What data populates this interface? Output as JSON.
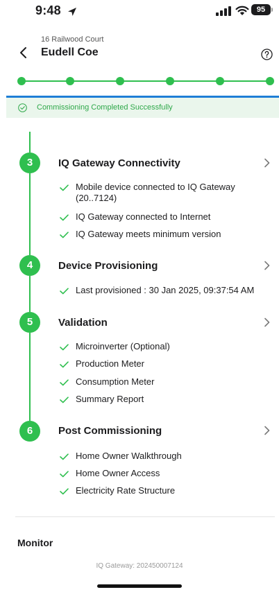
{
  "status_bar": {
    "time": "9:48",
    "battery": "95"
  },
  "header": {
    "address": "16 Railwood Court",
    "title": "Eudell Coe"
  },
  "stepper": {
    "steps_total": 6,
    "completed": 6
  },
  "banner": {
    "text": "Commissioning Completed Successfully"
  },
  "sections": [
    {
      "number": "3",
      "title": "IQ Gateway Connectivity",
      "items": [
        "Mobile device connected to IQ Gateway (20..7124)",
        "IQ Gateway connected to Internet",
        "IQ Gateway meets minimum version"
      ]
    },
    {
      "number": "4",
      "title": "Device Provisioning",
      "items": [
        "Last provisioned : 30 Jan 2025, 09:37:54 AM"
      ]
    },
    {
      "number": "5",
      "title": "Validation",
      "items": [
        "Microinverter (Optional)",
        "Production Meter",
        "Consumption Meter",
        "Summary Report"
      ]
    },
    {
      "number": "6",
      "title": "Post Commissioning",
      "items": [
        "Home Owner Walkthrough",
        "Home Owner Access",
        "Electricity Rate Structure"
      ]
    }
  ],
  "monitor": {
    "title": "Monitor",
    "gateway_id": "IQ Gateway: 202450007124"
  },
  "colors": {
    "accent_green": "#2fbf4f",
    "banner_bg": "#eaf6ec",
    "blue_line": "#1f7ed6"
  }
}
